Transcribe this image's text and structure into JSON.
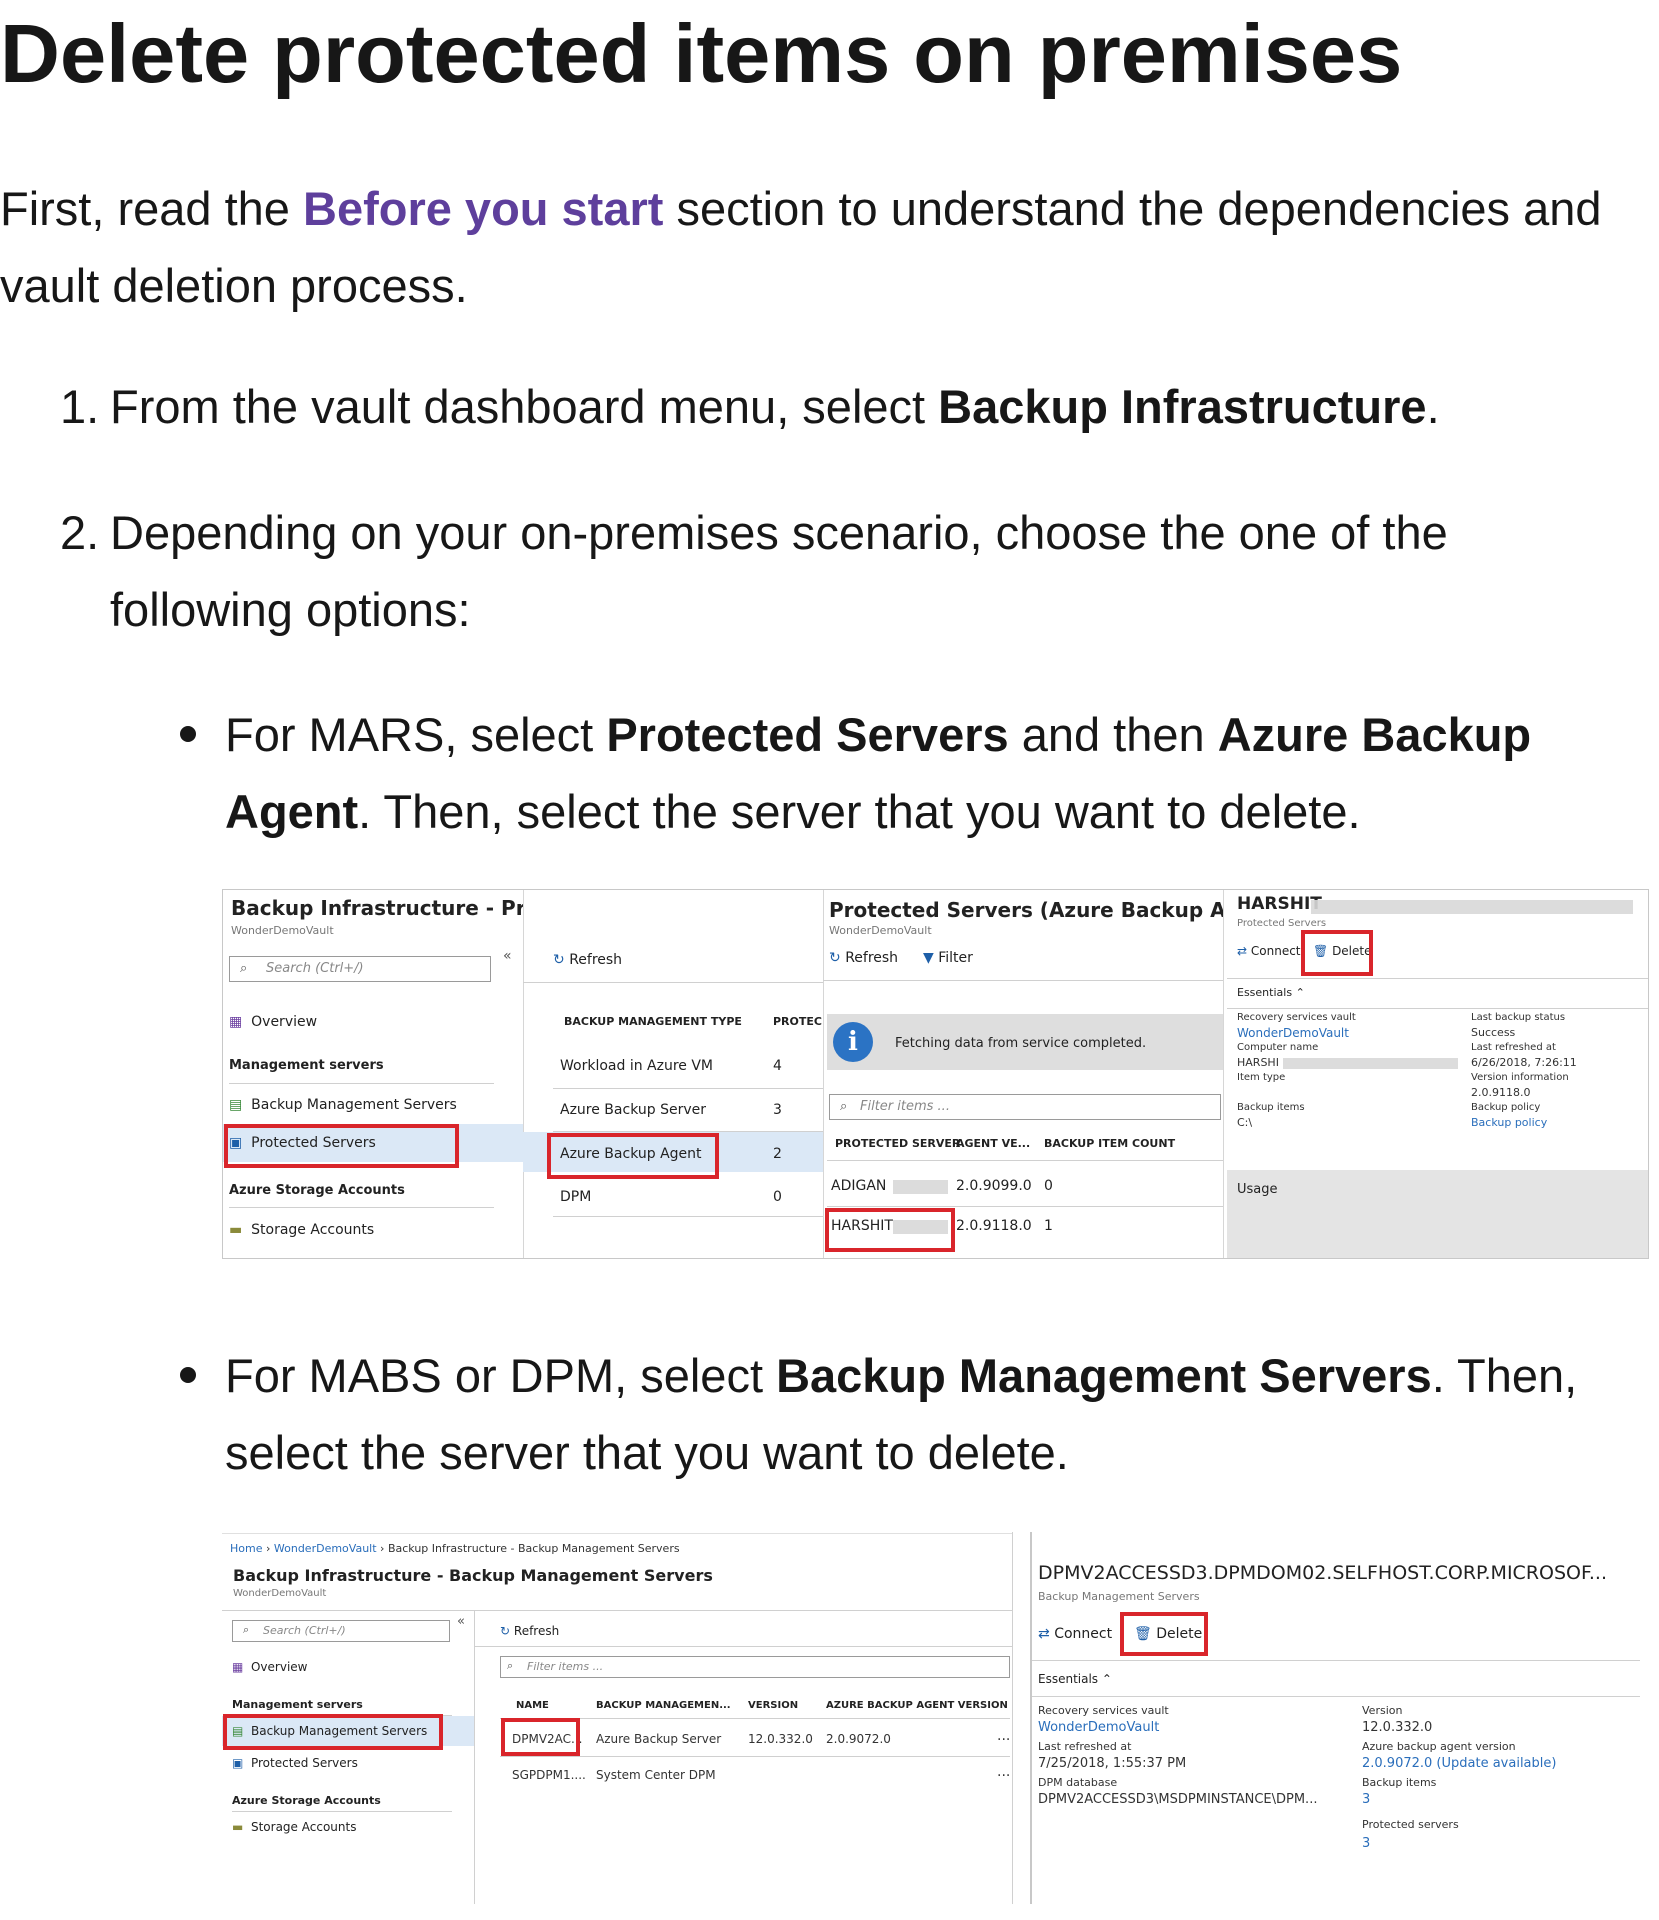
{
  "heading": "Delete protected items on premises",
  "intro": {
    "before": "First, read the ",
    "link": "Before you start",
    "after": " section to understand the dependencies and vault deletion process."
  },
  "steps": [
    {
      "num": "1.",
      "pre": "From the vault dashboard menu, select ",
      "bold": "Backup Infrastructure",
      "post": "."
    },
    {
      "num": "2.",
      "text": "Depending on your on-premises scenario, choose the one of the following options:"
    }
  ],
  "bullets": [
    {
      "pre": "For MARS, select ",
      "b1": "Protected Servers",
      "mid": " and then ",
      "b2": "Azure Backup Agent",
      "post": ". Then, select the server that you want to delete."
    },
    {
      "pre": "For MABS or DPM, select ",
      "b1": "Backup Management Servers",
      "post": ". Then, select the server that you want to delete."
    }
  ],
  "shot1": {
    "pane1": {
      "title": "Backup Infrastructure - Protected Servers",
      "sub": "WonderDemoVault",
      "search": "Search (Ctrl+/)",
      "collapse": "«",
      "overview": "Overview",
      "section1": "Management servers",
      "item1": "Backup Management Servers",
      "item2": "Protected Servers",
      "section2": "Azure Storage Accounts",
      "item3": "Storage Accounts"
    },
    "pane2": {
      "refresh": "Refresh",
      "col1": "BACKUP MANAGEMENT TYPE",
      "col2": "PROTEC",
      "rows": [
        {
          "type": "Workload in Azure VM",
          "count": "4"
        },
        {
          "type": "Azure Backup Server",
          "count": "3"
        },
        {
          "type": "Azure Backup Agent",
          "count": "2"
        },
        {
          "type": "DPM",
          "count": "0"
        }
      ]
    },
    "pane3": {
      "title": "Protected Servers (Azure Backup Agent)",
      "sub": "WonderDemoVault",
      "refresh": "Refresh",
      "filter": "Filter",
      "info": "Fetching data from service completed.",
      "filter_placeholder": "Filter items ...",
      "col1": "PROTECTED SERVER",
      "col2": "AGENT VE...",
      "col3": "BACKUP ITEM COUNT",
      "rows": [
        {
          "server": "ADIGAN",
          "version": "2.0.9099.0",
          "count": "0"
        },
        {
          "server": "HARSHIT",
          "version": "2.0.9118.0",
          "count": "1"
        }
      ]
    },
    "pane4": {
      "title": "HARSHIT",
      "sub": "Protected Servers",
      "connect": "Connect",
      "delete": "Delete",
      "essentials": "Essentials",
      "vault_label": "Recovery services vault",
      "vault_value": "WonderDemoVault",
      "computer_label": "Computer name",
      "computer_value": "HARSHI",
      "itemtype_label": "Item type",
      "items_label": "Backup items",
      "items_value": "C:\\",
      "status_label": "Last backup status",
      "status_value": "Success",
      "refreshed_label": "Last refreshed at",
      "refreshed_value": "6/26/2018, 7:26:11",
      "version_label": "Version information",
      "version_value": "2.0.9118.0",
      "policy_label": "Backup policy",
      "policy_value": "Backup policy",
      "usage": "Usage"
    }
  },
  "shot2": {
    "breadcrumb": [
      "Home",
      "WonderDemoVault",
      "Backup Infrastructure - Backup Management Servers"
    ],
    "pane1": {
      "title": "Backup Infrastructure - Backup Management Servers",
      "sub": "WonderDemoVault",
      "search": "Search (Ctrl+/)",
      "collapse": "«",
      "overview": "Overview",
      "section1": "Management servers",
      "item1": "Backup Management Servers",
      "item2": "Protected Servers",
      "section2": "Azure Storage Accounts",
      "item3": "Storage Accounts"
    },
    "pane2": {
      "refresh": "Refresh",
      "filter_placeholder": "Filter items ...",
      "col1": "NAME",
      "col2": "BACKUP MANAGEMEN...",
      "col3": "VERSION",
      "col4": "AZURE BACKUP AGENT VERSION",
      "rows": [
        {
          "name": "DPMV2AC...",
          "type": "Azure Backup Server",
          "version": "12.0.332.0",
          "agent": "2.0.9072.0"
        },
        {
          "name": "SGPDPM1....",
          "type": "System Center DPM",
          "version": "",
          "agent": ""
        }
      ],
      "more": "..."
    },
    "pane3": {
      "title": "DPMV2ACCESSD3.DPMDOM02.SELFHOST.CORP.MICROSOF...",
      "sub": "Backup Management Servers",
      "connect": "Connect",
      "delete": "Delete",
      "essentials": "Essentials",
      "vault_label": "Recovery services vault",
      "vault_value": "WonderDemoVault",
      "refreshed_label": "Last refreshed at",
      "refreshed_value": "7/25/2018, 1:55:37 PM",
      "db_label": "DPM database",
      "db_value": "DPMV2ACCESSD3\\MSDPMINSTANCE\\DPM...",
      "version_label": "Version",
      "version_value": "12.0.332.0",
      "agent_label": "Azure backup agent version",
      "agent_value": "2.0.9072.0 (Update available)",
      "items_label": "Backup items",
      "items_value": "3",
      "servers_label": "Protected servers",
      "servers_value": "3"
    }
  }
}
